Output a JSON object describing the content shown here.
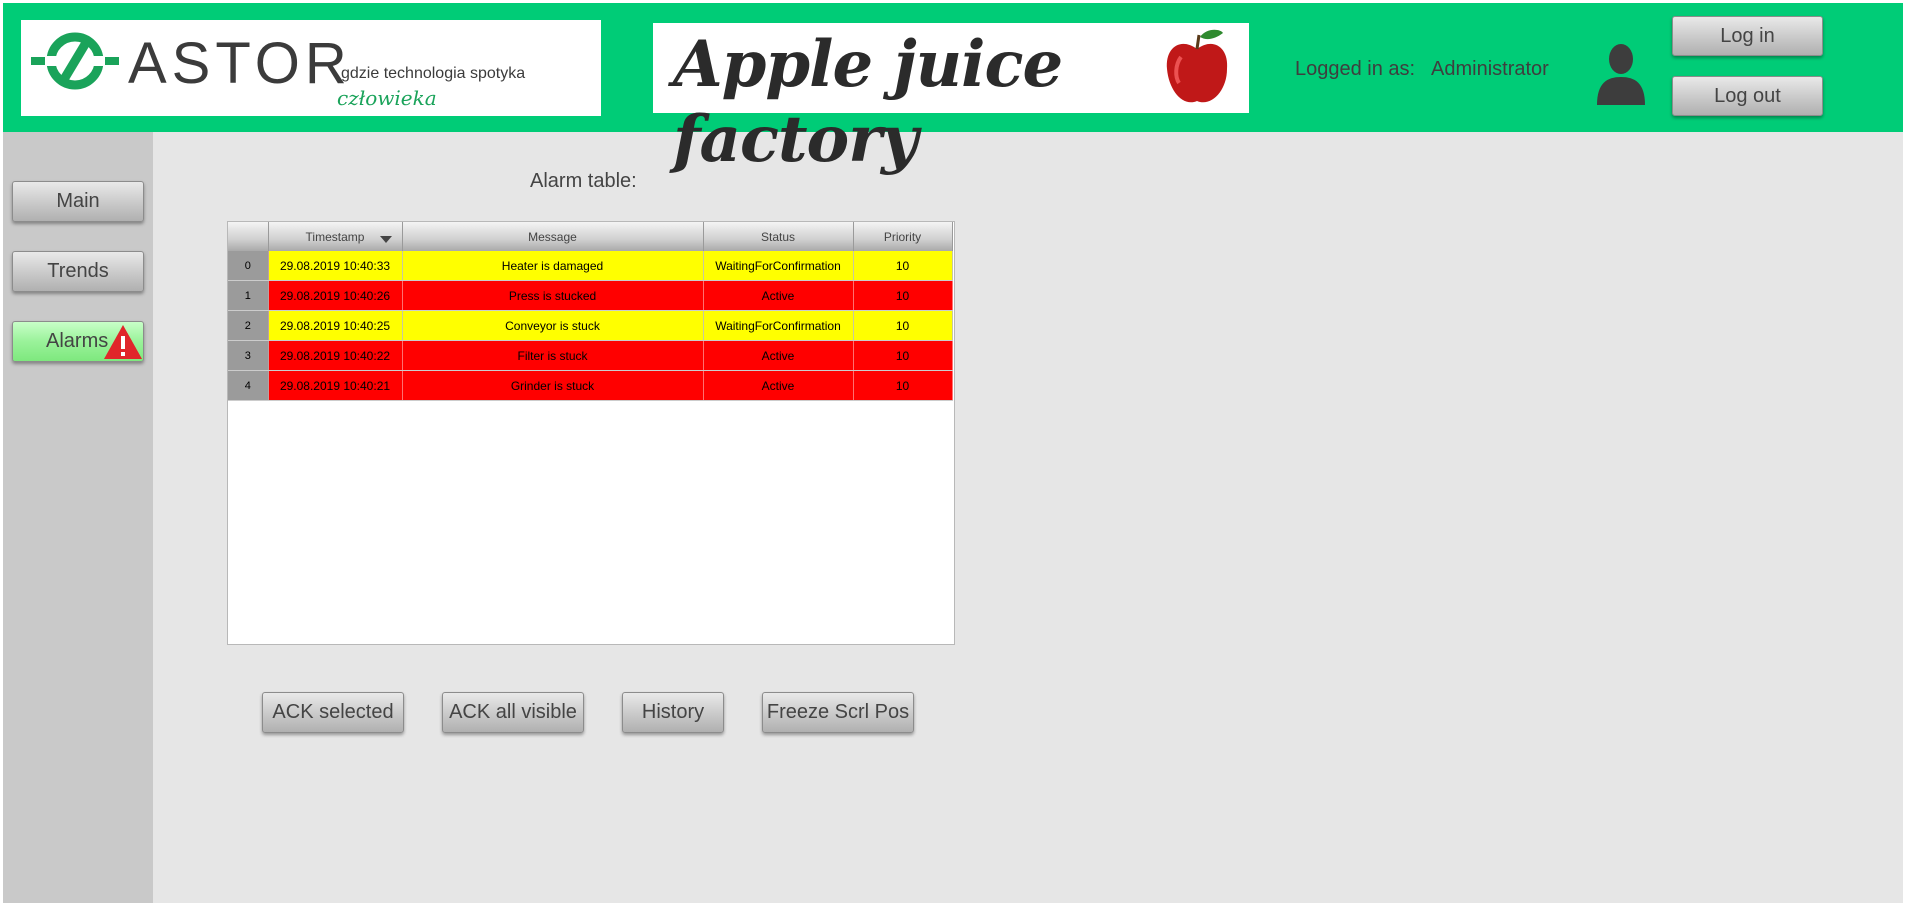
{
  "header": {
    "brand": {
      "name": "ASTOR",
      "tagline": "gdzie technologia spotyka",
      "script": "człowieka",
      "accent_color": "#1aa35a"
    },
    "app_title": "Apple juice factory",
    "logged_in_label": "Logged in as:",
    "logged_in_user": "Administrator",
    "login_label": "Log in",
    "logout_label": "Log out",
    "bar_color": "#00cc77"
  },
  "sidebar": {
    "items": [
      {
        "label": "Main"
      },
      {
        "label": "Trends"
      },
      {
        "label": "Alarms"
      }
    ]
  },
  "main": {
    "alarm_title": "Alarm table:",
    "table": {
      "columns": [
        "Timestamp",
        "Message",
        "Status",
        "Priority"
      ],
      "sort_column": "Timestamp",
      "rows": [
        {
          "index": "0",
          "timestamp": "29.08.2019 10:40:33",
          "message": "Heater is damaged",
          "status": "WaitingForConfirmation",
          "priority": "10",
          "color": "#ffff00"
        },
        {
          "index": "1",
          "timestamp": "29.08.2019 10:40:26",
          "message": "Press is stucked",
          "status": "Active",
          "priority": "10",
          "color": "#ff0000"
        },
        {
          "index": "2",
          "timestamp": "29.08.2019 10:40:25",
          "message": "Conveyor is stuck",
          "status": "WaitingForConfirmation",
          "priority": "10",
          "color": "#ffff00"
        },
        {
          "index": "3",
          "timestamp": "29.08.2019 10:40:22",
          "message": "Filter is stuck",
          "status": "Active",
          "priority": "10",
          "color": "#ff0000"
        },
        {
          "index": "4",
          "timestamp": "29.08.2019 10:40:21",
          "message": "Grinder is stuck",
          "status": "Active",
          "priority": "10",
          "color": "#ff0000"
        }
      ]
    },
    "buttons": {
      "ack_selected": "ACK selected",
      "ack_all_visible": "ACK all visible",
      "history": "History",
      "freeze": "Freeze Scrl Pos"
    }
  }
}
